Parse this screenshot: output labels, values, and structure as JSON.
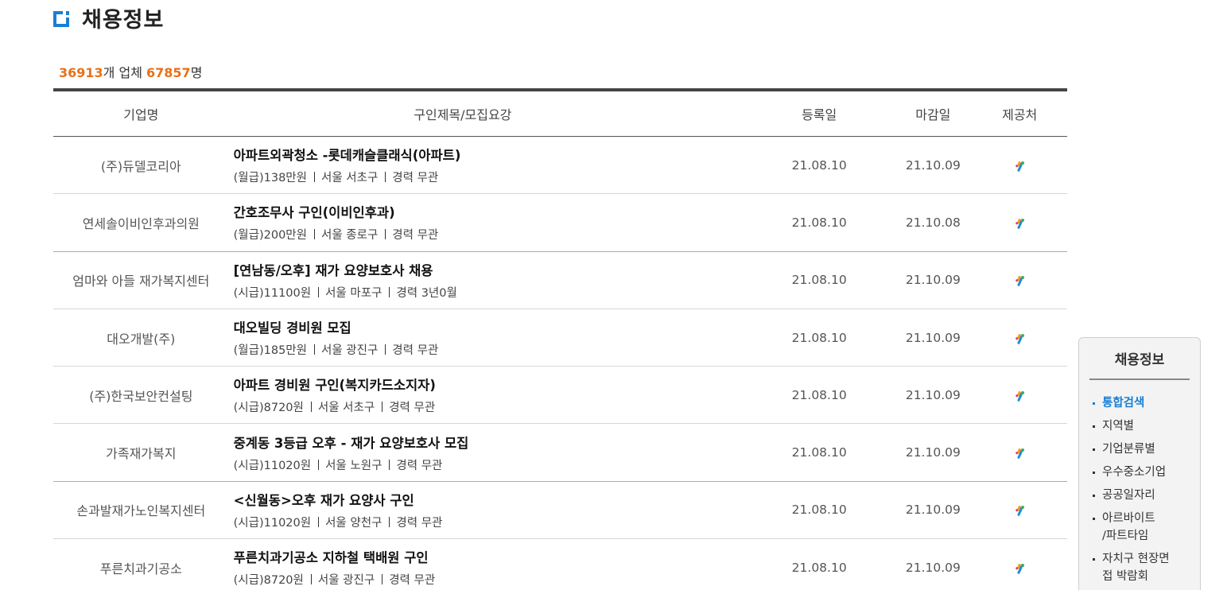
{
  "header": {
    "title": "채용정보"
  },
  "summary": {
    "company_count": "36913",
    "company_suffix": "개 업체 ",
    "person_count": "67857",
    "person_suffix": "명"
  },
  "table": {
    "columns": {
      "company": "기업명",
      "title": "구인제목/모집요강",
      "registered": "등록일",
      "deadline": "마감일",
      "provider": "제공처"
    },
    "rows": [
      {
        "company": "(주)듀델코리아",
        "title": "아파트외곽청소 -롯데캐슬클래식(아파트)",
        "pay": "(월급)138만원",
        "location": "서울 서초구",
        "career": "경력 무관",
        "registered": "21.08.10",
        "deadline": "21.10.09"
      },
      {
        "company": "연세솔이비인후과의원",
        "title": "간호조무사 구인(이비인후과)",
        "pay": "(월급)200만원",
        "location": "서울 종로구",
        "career": "경력 무관",
        "registered": "21.08.10",
        "deadline": "21.10.08"
      },
      {
        "company": "엄마와 아들 재가복지센터",
        "title": "[연남동/오후] 재가 요양보호사 채용",
        "pay": "(시급)11100원",
        "location": "서울 마포구",
        "career": "경력 3년0월",
        "registered": "21.08.10",
        "deadline": "21.10.09"
      },
      {
        "company": "대오개발(주)",
        "title": "대오빌딩 경비원 모집",
        "pay": "(월급)185만원",
        "location": "서울 광진구",
        "career": "경력 무관",
        "registered": "21.08.10",
        "deadline": "21.10.09"
      },
      {
        "company": "(주)한국보안컨설팅",
        "title": "아파트 경비원 구인(복지카드소지자)",
        "pay": "(시급)8720원",
        "location": "서울 서초구",
        "career": "경력 무관",
        "registered": "21.08.10",
        "deadline": "21.10.09"
      },
      {
        "company": "가족재가복지",
        "title": "중계동 3등급 오후 - 재가 요양보호사 모집",
        "pay": "(시급)11020원",
        "location": "서울 노원구",
        "career": "경력 무관",
        "registered": "21.08.10",
        "deadline": "21.10.09"
      },
      {
        "company": "손과발재가노인복지센터",
        "title": "<신월동>오후 재가 요양사 구인",
        "pay": "(시급)11020원",
        "location": "서울 양천구",
        "career": "경력 무관",
        "registered": "21.08.10",
        "deadline": "21.10.09"
      },
      {
        "company": "푸른치과기공소",
        "title": "푸른치과기공소 지하철 택배원 구인",
        "pay": "(시급)8720원",
        "location": "서울 광진구",
        "career": "경력 무관",
        "registered": "21.08.10",
        "deadline": "21.10.09"
      }
    ]
  },
  "sidebar": {
    "title": "채용정보",
    "items": [
      {
        "label": "통합검색",
        "active": true
      },
      {
        "label": "지역별"
      },
      {
        "label": "기업분류별"
      },
      {
        "label": "우수중소기업"
      },
      {
        "label": "공공일자리"
      },
      {
        "label": "아르바이트\n/파트타임"
      },
      {
        "label": "자치구 현장면\n접 박람회"
      }
    ]
  },
  "colors": {
    "accent": "#1a7fd4",
    "highlight": "#e8711a"
  }
}
